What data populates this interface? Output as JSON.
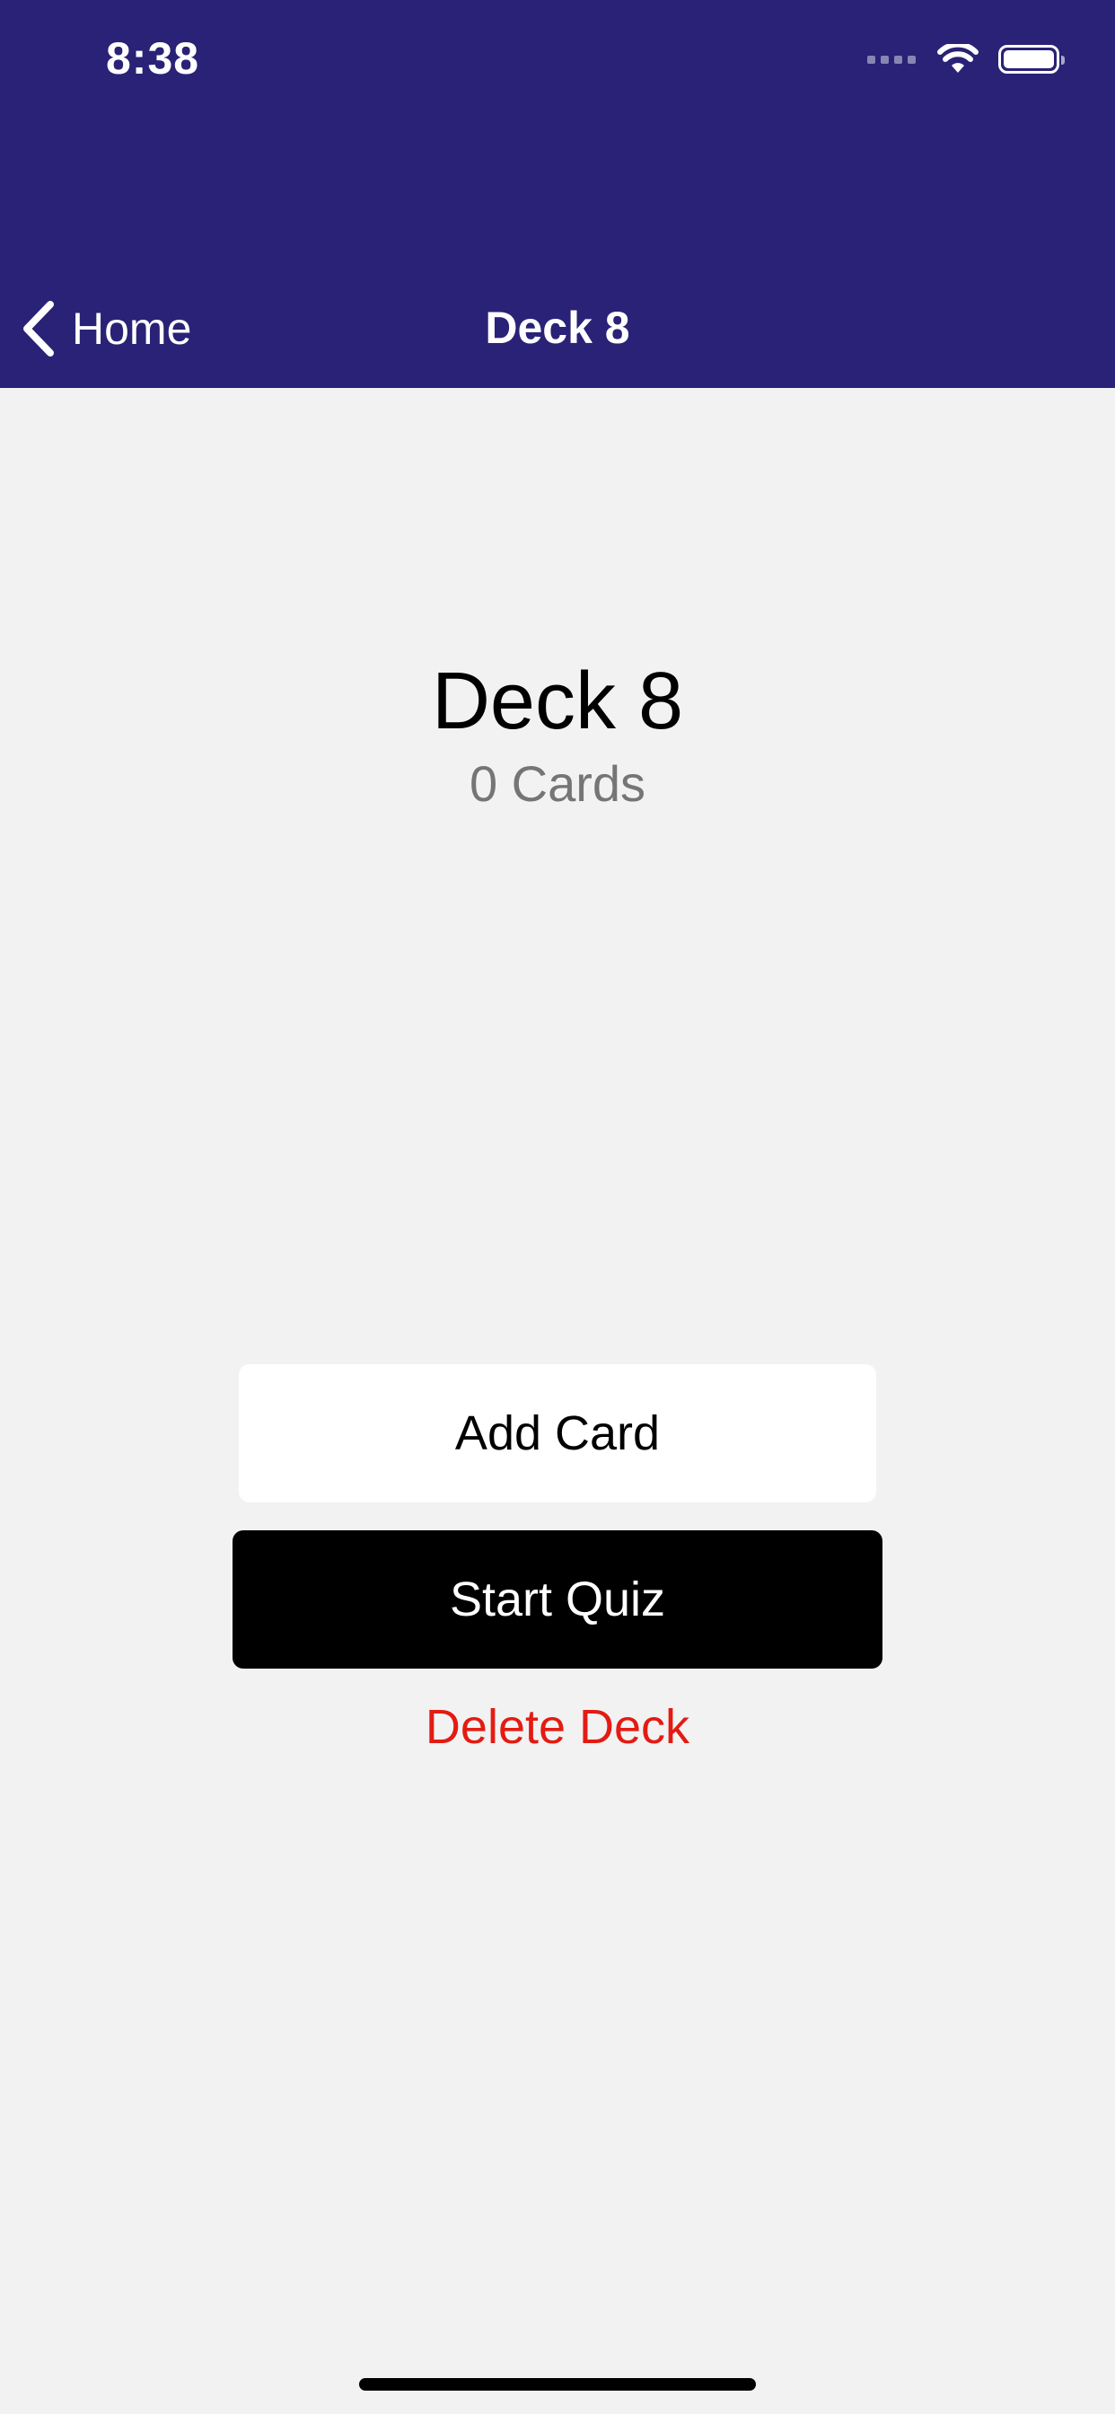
{
  "status_bar": {
    "time": "8:38",
    "signal_icon": "cellular-signal-icon",
    "wifi_icon": "wifi-icon",
    "battery_icon": "battery-icon"
  },
  "nav": {
    "back_label": "Home",
    "back_icon": "chevron-left-icon",
    "title": "Deck 8"
  },
  "deck": {
    "title": "Deck 8",
    "card_count": "0 Cards"
  },
  "actions": {
    "add_card": "Add Card",
    "start_quiz": "Start Quiz",
    "delete_deck": "Delete Deck"
  },
  "colors": {
    "header_bg": "#292276",
    "page_bg": "#f2f2f2",
    "delete": "#e31b13",
    "start_button_bg": "#000000",
    "add_button_bg": "#ffffff"
  }
}
